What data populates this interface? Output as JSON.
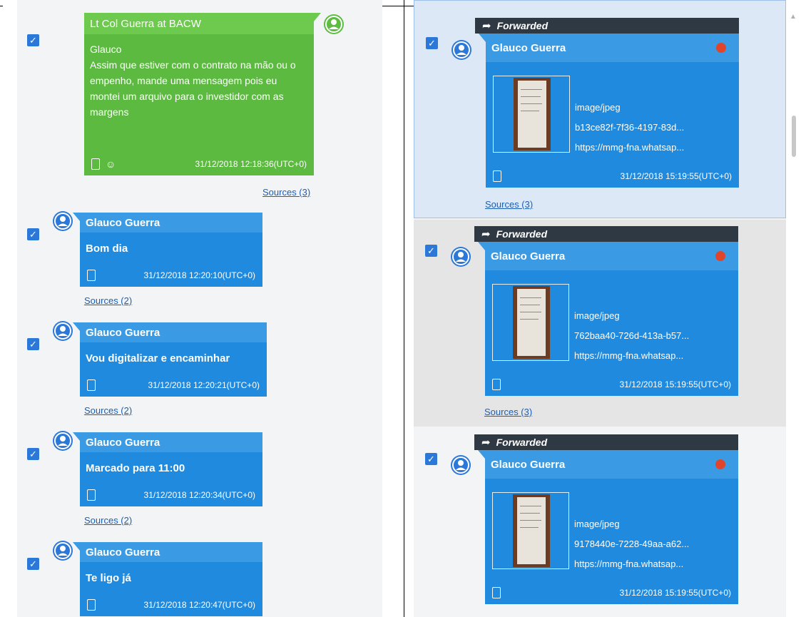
{
  "left_messages": [
    {
      "sender": "Lt Col Guerra at BACW",
      "body": "Glauco\nAssim que estiver com o contrato na mão ou o empenho, mande uma mensagem pois eu montei um arquivo para o investidor com as margens",
      "timestamp": "31/12/2018 12:18:36(UTC+0)",
      "sources": "Sources (3)",
      "color": "#5bba3f"
    },
    {
      "sender": "Glauco Guerra",
      "body": "Bom dia",
      "timestamp": "31/12/2018 12:20:10(UTC+0)",
      "sources": "Sources (2)",
      "color": "#1f8ade"
    },
    {
      "sender": "Glauco Guerra",
      "body": "Vou digitalizar e encaminhar",
      "timestamp": "31/12/2018 12:20:21(UTC+0)",
      "sources": "Sources (2)",
      "color": "#1f8ade"
    },
    {
      "sender": "Glauco Guerra",
      "body": "Marcado para 11:00",
      "timestamp": "31/12/2018 12:20:34(UTC+0)",
      "sources": "Sources (2)",
      "color": "#1f8ade"
    },
    {
      "sender": "Glauco Guerra",
      "body": "Te ligo já",
      "timestamp": "31/12/2018 12:20:47(UTC+0)",
      "sources": "",
      "color": "#1f8ade"
    }
  ],
  "right_messages": [
    {
      "forwarded_label": "Forwarded",
      "sender": "Glauco Guerra",
      "mime": "image/jpeg",
      "file_name": "b13ce82f-7f36-4197-83d...",
      "url": "https://mmg-fna.whatsap...",
      "timestamp": "31/12/2018 15:19:55(UTC+0)",
      "sources": "Sources (3)",
      "state": "selected"
    },
    {
      "forwarded_label": "Forwarded",
      "sender": "Glauco Guerra",
      "mime": "image/jpeg",
      "file_name": "762baa40-726d-413a-b57...",
      "url": "https://mmg-fna.whatsap...",
      "timestamp": "31/12/2018 15:19:55(UTC+0)",
      "sources": "Sources (3)",
      "state": "grey"
    },
    {
      "forwarded_label": "Forwarded",
      "sender": "Glauco Guerra",
      "mime": "image/jpeg",
      "file_name": "9178440e-7228-49aa-a62...",
      "url": "https://mmg-fna.whatsap...",
      "timestamp": "31/12/2018 15:19:55(UTC+0)",
      "sources": "",
      "state": "normal"
    }
  ],
  "colors": {
    "checkbox": "#2b78d8",
    "blue_bubble": "#1f8ade",
    "blue_header": "#3a9ae4",
    "green_bubble": "#5bba3f",
    "forwarded_bar": "#2e3944",
    "status_dot": "#e0452c",
    "link": "#1a5fb4"
  },
  "icons": {
    "checkbox": "check-icon",
    "avatar": "user-avatar-icon",
    "device": "phone-icon",
    "forward": "forward-arrow-icon",
    "contacts": "contacts-icon",
    "status": "red-dot-icon"
  }
}
